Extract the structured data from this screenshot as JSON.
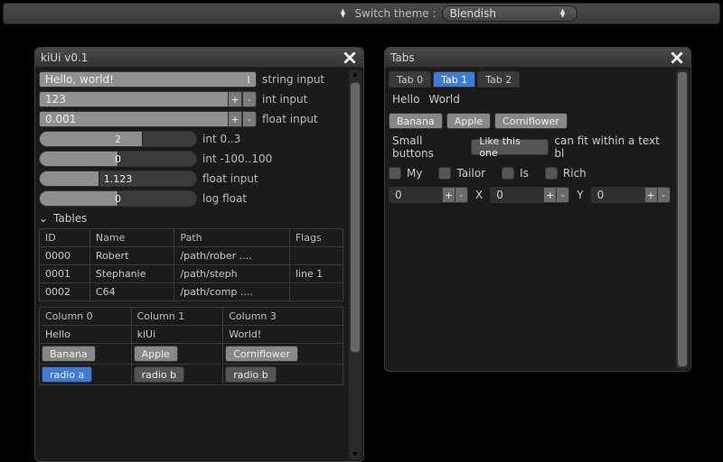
{
  "topbar": {
    "label": "Switch theme :",
    "value": "Blendish"
  },
  "win1": {
    "title": "kiUi v0.1",
    "fields": {
      "string_input": {
        "value": "Hello, world!",
        "label": "string input"
      },
      "int_input": {
        "value": "123",
        "label": "int input"
      },
      "float_input": {
        "value": "0.001",
        "label": "float input"
      },
      "slider_int": {
        "value": "2",
        "label": "int 0..3",
        "fill": 66
      },
      "slider_range": {
        "value": "0",
        "label": "int -100..100",
        "fill": 50
      },
      "slider_float": {
        "value": "1.123",
        "label": "float input",
        "fill": 38
      },
      "slider_log": {
        "value": "0",
        "label": "log float",
        "fill": 50
      }
    },
    "tree": {
      "header": "Tables",
      "table1": {
        "cols": [
          "ID",
          "Name",
          "Path",
          "Flags"
        ],
        "rows": [
          [
            "0000",
            "Robert",
            "/path/rober ....",
            ""
          ],
          [
            "0001",
            "Stephanie",
            "/path/steph",
            "line 1"
          ],
          [
            "0002",
            "C64",
            "/path/comp ....",
            ""
          ]
        ]
      },
      "table2": {
        "cols": [
          "Column 0",
          "Column 1",
          "Column 3"
        ],
        "row0": [
          "Hello",
          "kiUi",
          "World!"
        ],
        "tags": [
          "Banana",
          "Apple",
          "Corniflower"
        ],
        "radios": [
          "radio a",
          "radio b",
          "radio b"
        ]
      }
    }
  },
  "win2": {
    "title": "Tabs",
    "tabs": [
      "Tab 0",
      "Tab 1",
      "Tab 2"
    ],
    "active_tab": 1,
    "hello": [
      "Hello",
      "World"
    ],
    "tags": [
      "Banana",
      "Apple",
      "Corniflower"
    ],
    "line": {
      "pre": "Small buttons",
      "btn": "Like this one",
      "post": "can fit within a text bl"
    },
    "checks": [
      "My",
      "Tailor",
      "Is",
      "Rich"
    ],
    "xyz": {
      "x": "0",
      "y": "0",
      "z": "0"
    }
  }
}
